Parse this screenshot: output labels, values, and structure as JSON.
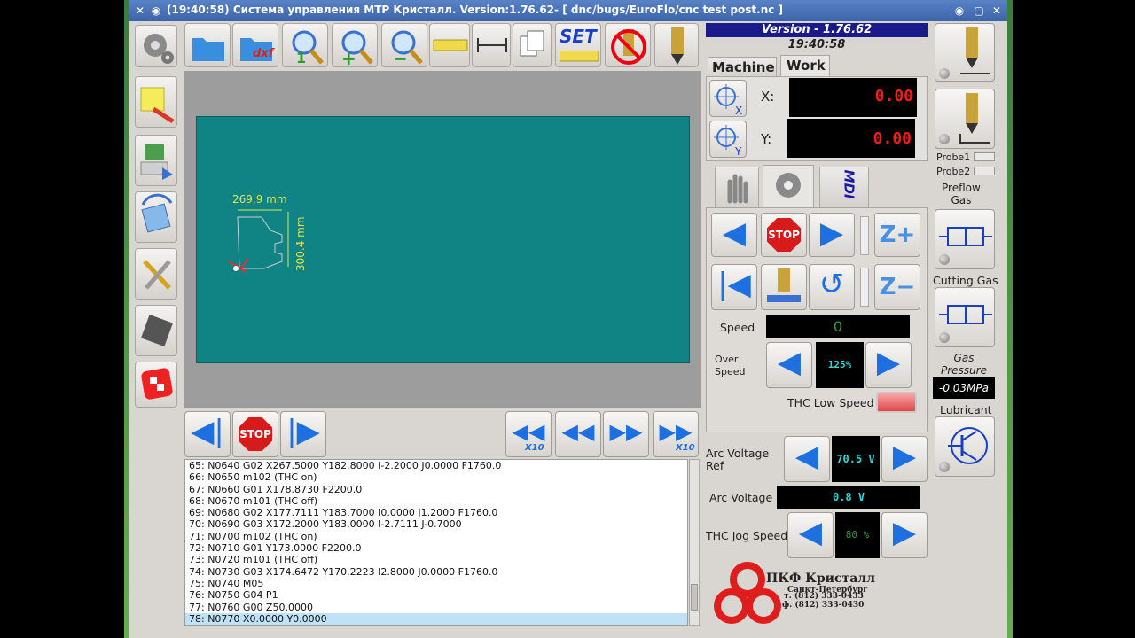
{
  "window": {
    "title": "(19:40:58)   Система управления МТР Кристалл.  Version:1.76.62-  [ dnc/bugs/EuroFlo/cnc test post.nc ]"
  },
  "version_panel": {
    "version": "Version - 1.76.62",
    "time": "19:40:58"
  },
  "coord_tabs": [
    {
      "label": "Machine"
    },
    {
      "label": "Work"
    }
  ],
  "coords": {
    "x_label": "X:",
    "x_value": "0.00",
    "y_label": "Y:",
    "y_value": "0.00"
  },
  "mode_tabs": {
    "mdi_label": "MDI"
  },
  "jog": {
    "stop_label": "STOP",
    "z_up_label": "Z+",
    "z_down_label": "Z−",
    "speed_label": "Speed",
    "speed_value": "0",
    "overspeed_label": "Over\nSpeed",
    "overspeed_value": "125%",
    "thc_low_speed_label": "THC Low Speed"
  },
  "thc": {
    "arc_voltage_ref_label": "Arc Voltage\nRef",
    "arc_voltage_ref_value": "70.5 V",
    "arc_voltage_label": "Arc Voltage",
    "arc_voltage_value": "0.8 V",
    "jog_speed_label": "THC Jog Speed",
    "jog_speed_value": "80 %"
  },
  "right_panel": {
    "probe1": "Probe1",
    "probe2": "Probe2",
    "preflow_gas": "Preflow\nGas",
    "cutting_gas": "Cutting Gas",
    "gas_pressure_label": "Gas\nPressure",
    "gas_pressure_value": "-0.03MPa",
    "lubricant": "Lubricant"
  },
  "toolbar": {
    "set_label": "SET",
    "dxf_label": "dxf"
  },
  "drawing": {
    "width_dim": "269.9 mm",
    "height_dim": "300.4 mm"
  },
  "program_controls": {
    "stop_label": "STOP",
    "x10_label": "X10"
  },
  "gcode_lines": [
    "65: N0640 G02 X267.5000 Y182.8000 I-2.2000 J0.0000 F1760.0",
    "66: N0650 m102 (THC on)",
    "67: N0660 G01 X178.8730 F2200.0",
    "68: N0670 m101 (THC off)",
    "69: N0680 G02 X177.7111 Y183.7000 I0.0000 J1.2000 F1760.0",
    "70: N0690 G03 X172.2000 Y183.0000 I-2.7111 J-0.7000",
    "71: N0700 m102 (THC on)",
    "72: N0710 G01 Y173.0000 F2200.0",
    "73: N0720 m101 (THC off)",
    "74: N0730 G03 X174.6472 Y170.2223 I2.8000 J0.0000 F1760.0",
    "75: N0740 M05",
    "76: N0750 G04 P1",
    "77: N0760 G00 Z50.0000",
    "78: N0770 X0.0000 Y0.0000"
  ],
  "logo": {
    "company": "ПКФ Кристалл",
    "city": "Санкт-Петербург",
    "phone": "т. (812) 333-0433",
    "fax": "ф. (812) 333-0430"
  }
}
